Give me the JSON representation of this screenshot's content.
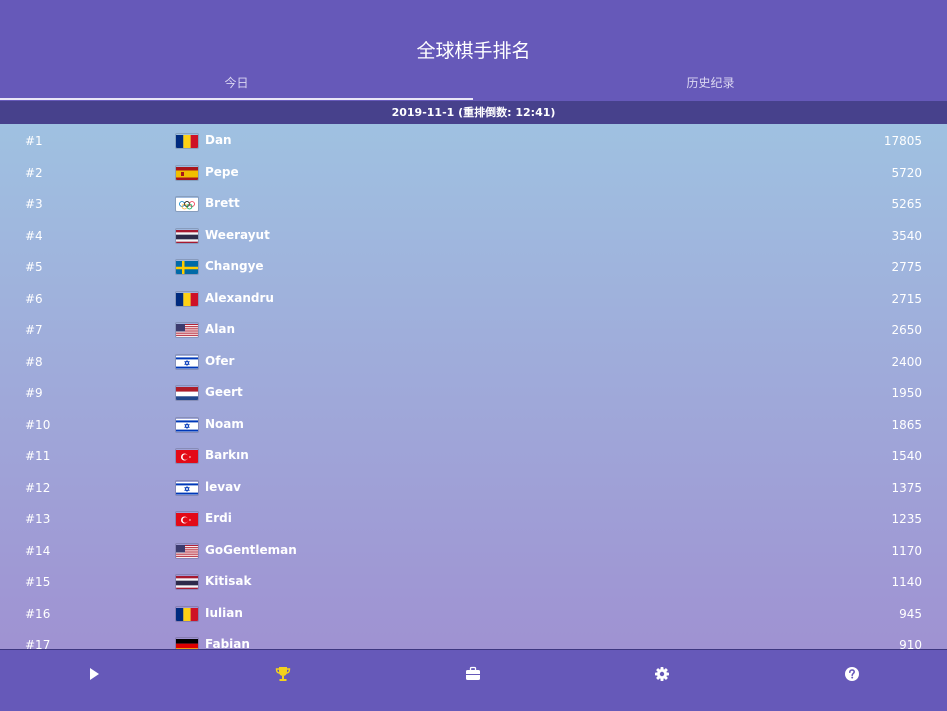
{
  "header": {
    "title": "全球棋手排名",
    "tabs": [
      {
        "label": "今日",
        "active": true
      },
      {
        "label": "历史纪录",
        "active": false
      }
    ]
  },
  "date_bar": {
    "text": "2019-11-1 (重排倒数: 12:41)"
  },
  "colors": {
    "header_bg": "#6659b9",
    "date_bar_bg": "#47418c",
    "list_gradient_top": "#9fc1e1",
    "list_gradient_bottom": "#9f92d2",
    "trophy_active": "#f4d21c"
  },
  "rankings": [
    {
      "rank": "#1",
      "flag": "romania",
      "name": "Dan",
      "score": "17805"
    },
    {
      "rank": "#2",
      "flag": "spain",
      "name": "Pepe",
      "score": "5720"
    },
    {
      "rank": "#3",
      "flag": "olympic",
      "name": "Brett",
      "score": "5265"
    },
    {
      "rank": "#4",
      "flag": "thailand",
      "name": "Weerayut",
      "score": "3540"
    },
    {
      "rank": "#5",
      "flag": "sweden",
      "name": "Changye",
      "score": "2775"
    },
    {
      "rank": "#6",
      "flag": "romania",
      "name": "Alexandru",
      "score": "2715"
    },
    {
      "rank": "#7",
      "flag": "usa",
      "name": "Alan",
      "score": "2650"
    },
    {
      "rank": "#8",
      "flag": "israel",
      "name": "Ofer",
      "score": "2400"
    },
    {
      "rank": "#9",
      "flag": "netherlands",
      "name": "Geert",
      "score": "1950"
    },
    {
      "rank": "#10",
      "flag": "israel",
      "name": "Noam",
      "score": "1865"
    },
    {
      "rank": "#11",
      "flag": "turkey",
      "name": "Barkın",
      "score": "1540"
    },
    {
      "rank": "#12",
      "flag": "israel",
      "name": "levav",
      "score": "1375"
    },
    {
      "rank": "#13",
      "flag": "turkey",
      "name": "Erdi",
      "score": "1235"
    },
    {
      "rank": "#14",
      "flag": "usa",
      "name": "GoGentleman",
      "score": "1170"
    },
    {
      "rank": "#15",
      "flag": "thailand",
      "name": "Kitisak",
      "score": "1140"
    },
    {
      "rank": "#16",
      "flag": "romania",
      "name": "Iulian",
      "score": "945"
    },
    {
      "rank": "#17",
      "flag": "germany",
      "name": "Fabian",
      "score": "910"
    }
  ],
  "bottom_nav": [
    {
      "icon": "play-icon",
      "active": false
    },
    {
      "icon": "trophy-icon",
      "active": true
    },
    {
      "icon": "briefcase-icon",
      "active": false
    },
    {
      "icon": "gear-icon",
      "active": false
    },
    {
      "icon": "help-icon",
      "active": false
    }
  ]
}
